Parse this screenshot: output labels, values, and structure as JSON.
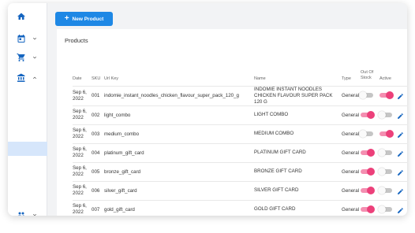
{
  "colors": {
    "accent": "#1e88e5",
    "toggle_on": "#ec407a",
    "sidebar_selected": "#d6e6fb"
  },
  "sidebar": {
    "items": [
      {
        "icon": "home-icon",
        "expanded": null
      },
      {
        "icon": "calendar-icon",
        "expanded": false
      },
      {
        "icon": "cart-icon",
        "expanded": false
      },
      {
        "icon": "bank-icon",
        "expanded": true
      },
      {
        "icon": "users-icon",
        "expanded": false
      }
    ]
  },
  "toolbar": {
    "new_product_label": "New Product"
  },
  "products": {
    "title": "Products",
    "columns": {
      "date": "Date",
      "sku": "SKU",
      "url_key": "Url Key",
      "name": "Name",
      "type": "Type",
      "out_of_stock": "Out Of Stock",
      "active": "Active"
    },
    "rows": [
      {
        "date": "Sep 6, 2022",
        "sku": "001",
        "url_key": "indomie_instant_noodles_chicken_flavour_super_pack_120_g",
        "name": "INDOMIE INSTANT NOODLES CHICKEN FLAVOUR SUPER PACK 120 G",
        "type": "General",
        "out_of_stock": false,
        "active": true
      },
      {
        "date": "Sep 6, 2022",
        "sku": "002",
        "url_key": "light_combo",
        "name": "LIGHT COMBO",
        "type": "General",
        "out_of_stock": true,
        "active": false
      },
      {
        "date": "Sep 6, 2022",
        "sku": "003",
        "url_key": "medium_combo",
        "name": "MEDIUM COMBO",
        "type": "General",
        "out_of_stock": false,
        "active": true
      },
      {
        "date": "Sep 6, 2022",
        "sku": "004",
        "url_key": "platinum_gift_card",
        "name": "PLATINUM GIFT CARD",
        "type": "General",
        "out_of_stock": true,
        "active": false
      },
      {
        "date": "Sep 6, 2022",
        "sku": "005",
        "url_key": "bronze_gift_card",
        "name": "BRONZE GIFT CARD",
        "type": "General",
        "out_of_stock": true,
        "active": false
      },
      {
        "date": "Sep 6, 2022",
        "sku": "006",
        "url_key": "silver_gift_card",
        "name": "SILVER GIFT CARD",
        "type": "General",
        "out_of_stock": true,
        "active": false
      },
      {
        "date": "Sep 6, 2022",
        "sku": "007",
        "url_key": "gold_gift_card",
        "name": "GOLD GIFT CARD",
        "type": "General",
        "out_of_stock": true,
        "active": false
      }
    ]
  }
}
